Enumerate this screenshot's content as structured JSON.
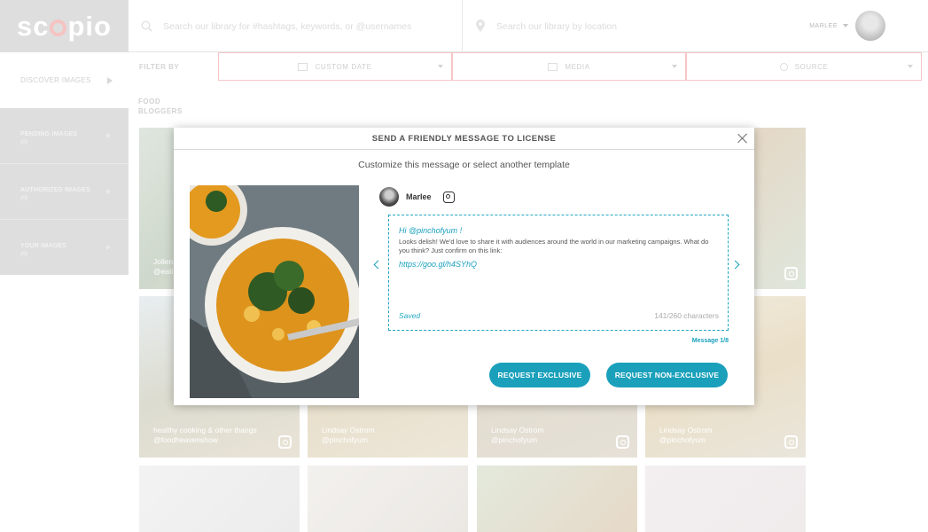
{
  "brand": {
    "logo_text_left": "sc",
    "logo_text_right": "pio"
  },
  "header": {
    "search_hashtags_placeholder": "Search our library for #hashtags, keywords, or @usernames",
    "search_location_placeholder": "Search our library by location",
    "user_name": "MARLEE"
  },
  "filters": {
    "label": "FILTER BY",
    "custom_date": "CUSTOM DATE",
    "media": "MEDIA",
    "source": "SOURCE"
  },
  "breadcrumb": "FOOD BLOGGERS",
  "sidebar": {
    "discover": "DISCOVER IMAGES",
    "items": [
      {
        "label": "PENDING IMAGES",
        "count": "(0)"
      },
      {
        "label": "AUTHORIZED IMAGES",
        "count": "(0)"
      },
      {
        "label": "YOUR IMAGES",
        "count": "(0)"
      }
    ]
  },
  "grid": {
    "tiles": [
      {
        "caption_1": "Jollen",
        "caption_2": "@eati"
      },
      {
        "caption_1": "",
        "caption_2": ""
      },
      {
        "caption_1": "",
        "caption_2": ""
      },
      {
        "caption_1": "",
        "caption_2": ""
      },
      {
        "caption_1": "healthy cooking & other thangs",
        "caption_2": "@foodheavenshow"
      },
      {
        "caption_1": "Lindsay Ostrom",
        "caption_2": "@pinchofyum"
      },
      {
        "caption_1": "Lindsay Ostrom",
        "caption_2": "@pinchofyum"
      },
      {
        "caption_1": "Lindsay Ostrom",
        "caption_2": "@pinchofyum"
      }
    ]
  },
  "modal": {
    "title": "SEND A FRIENDLY MESSAGE TO LICENSE",
    "subtitle": "Customize this message or select another template",
    "sender_name": "Marlee",
    "message": {
      "greeting": "Hi @pinchofyum !",
      "body": "Looks delish! We'd love to share it with audiences around the world in our marketing campaigns. What do you think? Just confirm on this link:",
      "link": "https://goo.gl/h4SYhQ",
      "status": "Saved",
      "char_count": "141/260 characters"
    },
    "message_index": "Message 1/8",
    "buttons": {
      "exclusive": "REQUEST EXCLUSIVE",
      "non_exclusive": "REQUEST NON-EXCLUSIVE"
    }
  },
  "colors": {
    "accent": "#1aa0bb",
    "filter_border": "#f6c4c4",
    "sidebar_bg": "#dedede"
  },
  "icons": [
    "search-icon",
    "location-pin-icon",
    "calendar-icon",
    "media-icon",
    "source-icon",
    "instagram-icon",
    "close-icon",
    "chevron-left-icon",
    "chevron-right-icon"
  ]
}
